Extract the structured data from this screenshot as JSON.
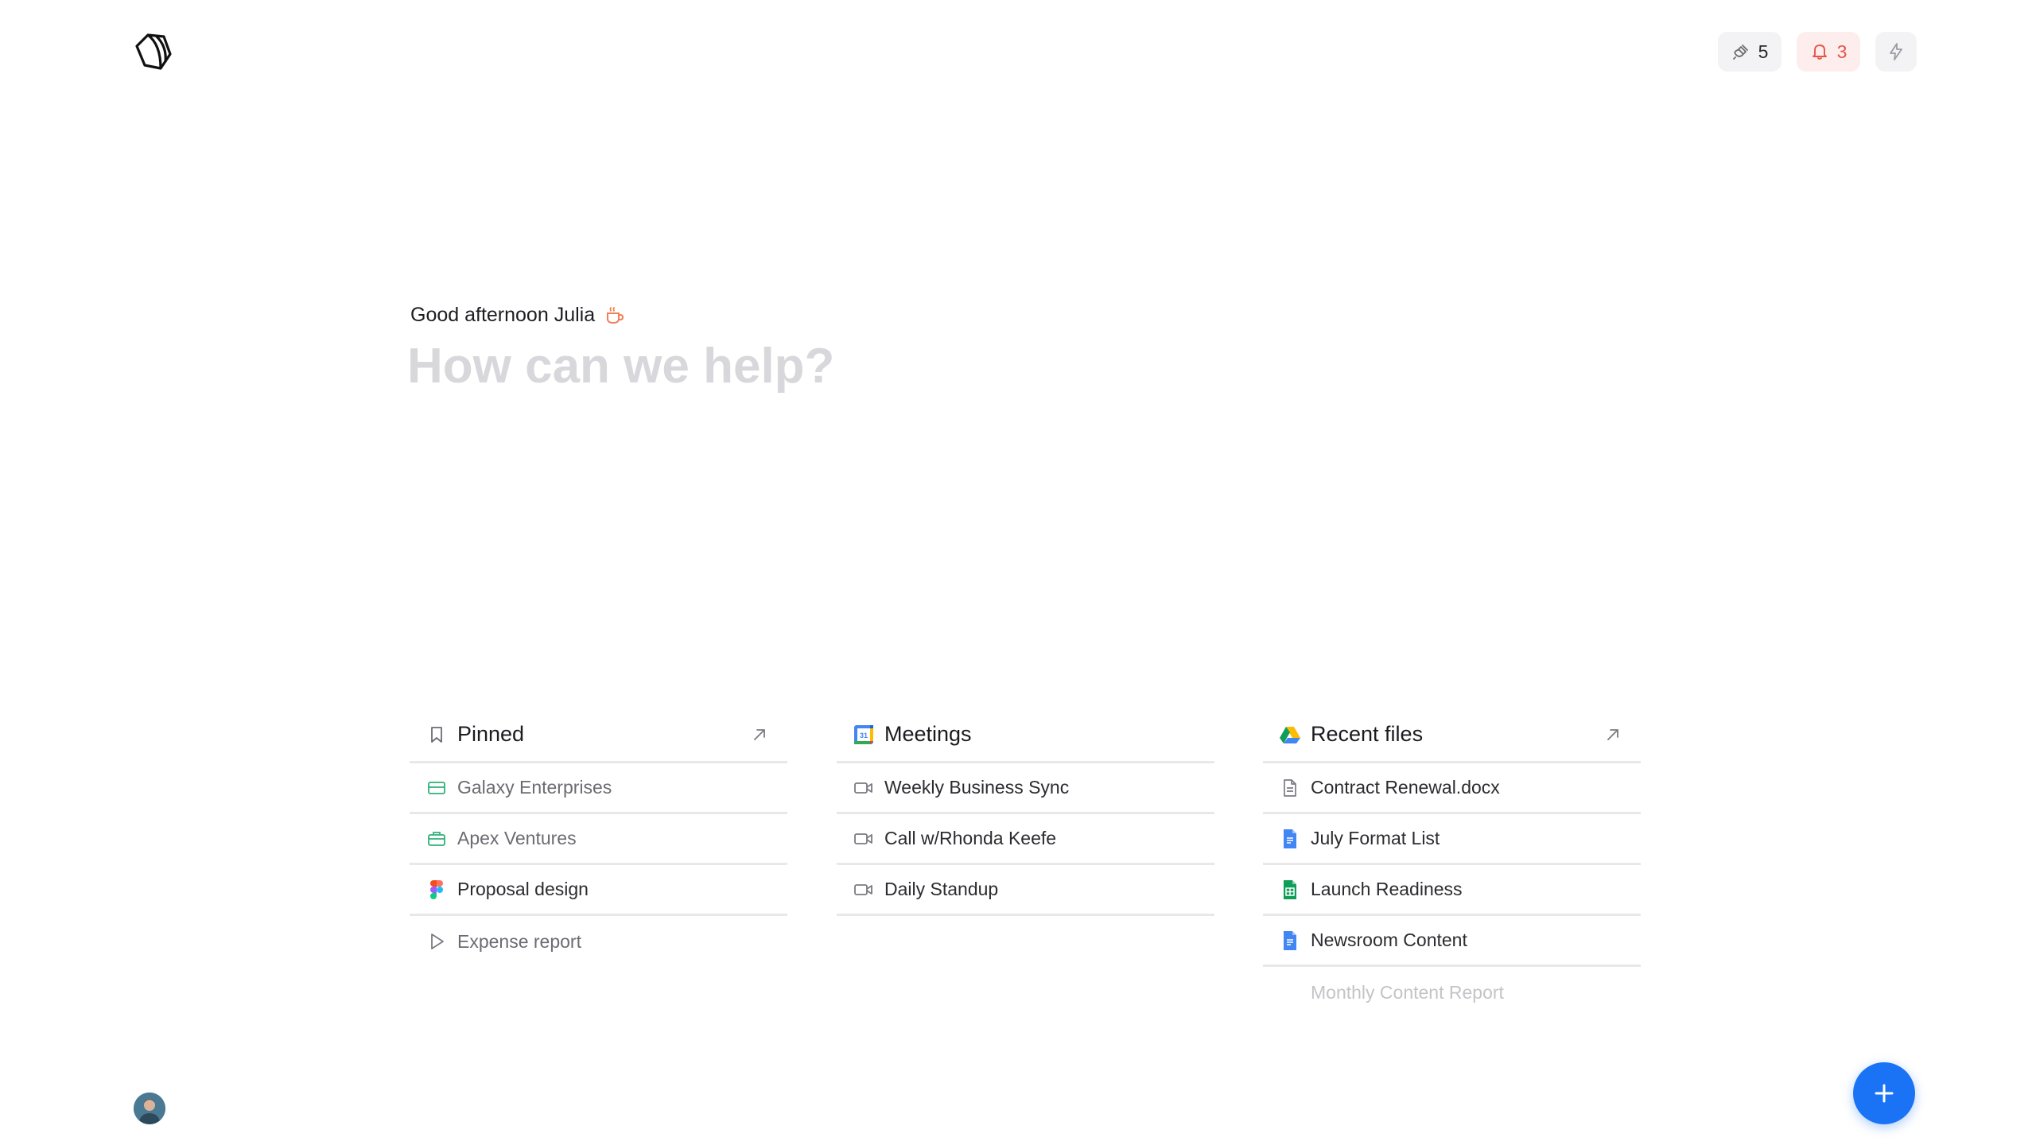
{
  "header": {
    "plugins_count": "5",
    "notifications_count": "3",
    "colors": {
      "alert": "#e5564a",
      "alert_bg": "#fdeeed",
      "neutral_bg": "#f3f3f5"
    }
  },
  "greeting": {
    "text": "Good afternoon Julia",
    "icon": "coffee-icon"
  },
  "prompt": {
    "placeholder": "How can we help?",
    "value": ""
  },
  "pinned": {
    "title": "Pinned",
    "icon": "bookmark-icon",
    "items": [
      {
        "label": "Galaxy Enterprises",
        "icon": "card-icon"
      },
      {
        "label": "Apex Ventures",
        "icon": "briefcase-icon"
      },
      {
        "label": "Proposal design",
        "icon": "figma-icon"
      },
      {
        "label": "Expense report",
        "icon": "play-icon"
      }
    ]
  },
  "meetings": {
    "title": "Meetings",
    "icon": "google-calendar-icon",
    "items": [
      {
        "label": "Weekly Business Sync",
        "icon": "video-icon"
      },
      {
        "label": "Call w/Rhonda Keefe",
        "icon": "video-icon"
      },
      {
        "label": "Daily Standup",
        "icon": "video-icon"
      }
    ]
  },
  "recent_files": {
    "title": "Recent files",
    "icon": "google-drive-icon",
    "items": [
      {
        "label": "Contract Renewal.docx",
        "icon": "document-icon"
      },
      {
        "label": "July Format List",
        "icon": "google-docs-icon"
      },
      {
        "label": "Launch Readiness",
        "icon": "google-sheets-icon"
      },
      {
        "label": "Newsroom Content",
        "icon": "google-docs-icon"
      },
      {
        "label": "Monthly Content Report",
        "icon": ""
      }
    ]
  },
  "fab": {
    "icon": "plus-icon",
    "color": "#1a73f5"
  }
}
